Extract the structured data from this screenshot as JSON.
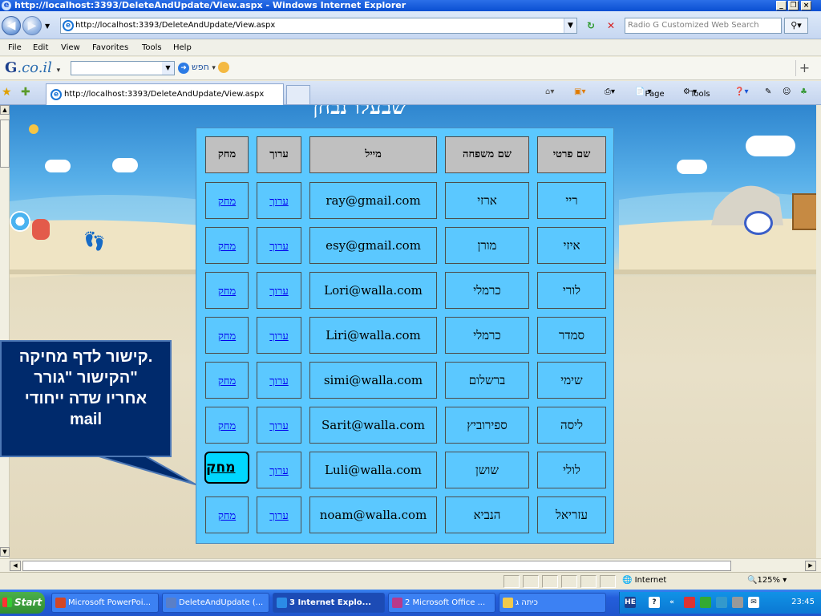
{
  "window": {
    "title": "http://localhost:3393/DeleteAndUpdate/View.aspx - Windows Internet Explorer"
  },
  "address": {
    "url": "http://localhost:3393/DeleteAndUpdate/View.aspx",
    "search_placeholder": "Radio G Customized Web Search"
  },
  "menu": [
    "File",
    "Edit",
    "View",
    "Favorites",
    "Tools",
    "Help"
  ],
  "gtoolbar": {
    "logo_g": "G",
    "logo_rest": ".co.il",
    "search_label": "חפש"
  },
  "tab": {
    "label": "http://localhost:3393/DeleteAndUpdate/View.aspx"
  },
  "commandbar": {
    "page": "Page",
    "tools": "Tools"
  },
  "content": {
    "heading_fragment": "שבעלו נבחן",
    "table": {
      "headers": {
        "first_name": "שם פרטי",
        "last_name": "שם משפחה",
        "mail": "מייל",
        "edit": "ערוך",
        "delete": "מחק"
      },
      "rows": [
        {
          "first_name": "ריי",
          "last_name": "ארזי",
          "mail": "ray@gmail.com",
          "edit": "ערוך",
          "delete": "מחק"
        },
        {
          "first_name": "איזי",
          "last_name": "מורן",
          "mail": "esy@gmail.com",
          "edit": "ערוך",
          "delete": "מחק"
        },
        {
          "first_name": "לורי",
          "last_name": "כרמלי",
          "mail": "Lori@walla.com",
          "edit": "ערוך",
          "delete": "מחק"
        },
        {
          "first_name": "סמדר",
          "last_name": "כרמלי",
          "mail": "Liri@walla.com",
          "edit": "ערוך",
          "delete": "מחק"
        },
        {
          "first_name": "שימי",
          "last_name": "ברשלום",
          "mail": "simi@walla.com",
          "edit": "ערוך",
          "delete": "מחק"
        },
        {
          "first_name": "ליסה",
          "last_name": "ספירוביץ",
          "mail": "Sarit@walla.com",
          "edit": "ערוך",
          "delete": "מחק"
        },
        {
          "first_name": "לולי",
          "last_name": "שושן",
          "mail": "Luli@walla.com",
          "edit": "ערוך",
          "delete": "מחק"
        },
        {
          "first_name": "עזריאל",
          "last_name": "הנביא",
          "mail": "noam@walla.com",
          "edit": "ערוך",
          "delete": "מחק"
        }
      ]
    },
    "callout": {
      "line1": "קישור לדף מחיקה.",
      "line2": "הקישור \"גורר\"",
      "line3": "אחריו שדה ייחודי",
      "line4": "mail"
    }
  },
  "statusbar": {
    "zone": "Internet",
    "zoom": "125%"
  },
  "taskbar": {
    "start": "Start",
    "tasks": [
      {
        "label": "Microsoft PowerPoi...",
        "color": "#d24726"
      },
      {
        "label": "DeleteAndUpdate (...",
        "color": "#5a7fc7"
      },
      {
        "label": "3 Internet Explo...",
        "color": "#2b8be6"
      },
      {
        "label": "2 Microsoft Office ...",
        "color": "#b73a8c"
      },
      {
        "label": "כיתה ג",
        "color": "#f2c94c"
      }
    ],
    "tray_lang": "HE",
    "clock": "23:45"
  },
  "colors": {
    "table_bg": "#5bc8ff",
    "header_bg": "#c0c0c0",
    "callout_bg": "#002a6c",
    "highlight": "#00d7ff",
    "link": "#0000ee"
  }
}
